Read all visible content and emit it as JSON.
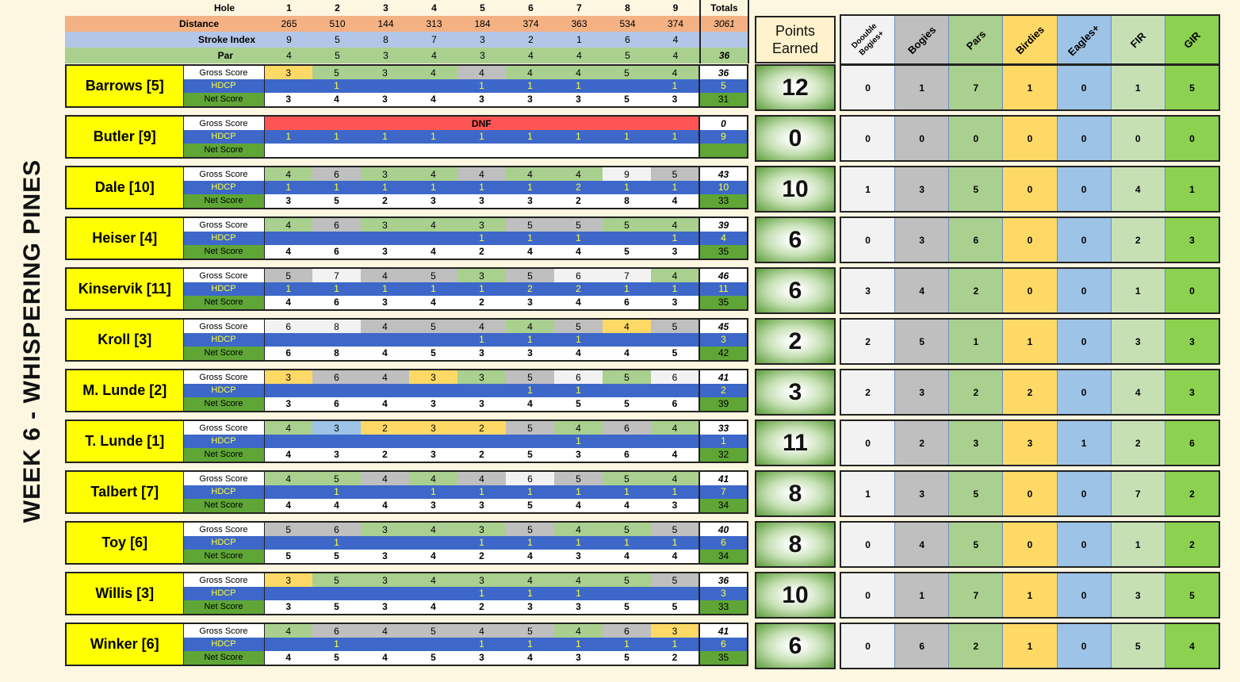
{
  "title": "WEEK 6 - WHISPERING PINES",
  "header": {
    "hole_label": "Hole",
    "holes": [
      "1",
      "2",
      "3",
      "4",
      "5",
      "6",
      "7",
      "8",
      "9"
    ],
    "totals_label": "Totals",
    "distance_label": "Distance",
    "distances": [
      "265",
      "510",
      "144",
      "313",
      "184",
      "374",
      "363",
      "534",
      "374"
    ],
    "distance_total": "3061",
    "stroke_index_label": "Stroke Index",
    "stroke_index": [
      "9",
      "5",
      "8",
      "7",
      "3",
      "2",
      "1",
      "6",
      "4"
    ],
    "par_label": "Par",
    "par": [
      "4",
      "5",
      "3",
      "4",
      "3",
      "4",
      "4",
      "5",
      "4"
    ],
    "par_total": "36"
  },
  "row_labels": {
    "gross": "Gross Score",
    "hdcp": "HDCP",
    "net": "Net Score"
  },
  "points_header": {
    "line1": "Points",
    "line2": "Earned"
  },
  "stats_header": [
    "Doouble Bogies+",
    "Bogies",
    "Pars",
    "Birdies",
    "Eagles+",
    "FIR",
    "GIR"
  ],
  "colors": {
    "name_bg": "#ffff00",
    "hdcp_bg": "#3d68c9",
    "hdcp_text": "#ffff33",
    "net_label_bg": "#5fa636",
    "dnf": "#ff5555"
  },
  "players": [
    {
      "name": "Barrows [5]",
      "gross": [
        "3",
        "5",
        "3",
        "4",
        "4",
        "4",
        "4",
        "5",
        "4"
      ],
      "gross_class": [
        "y",
        "g",
        "g",
        "g",
        "x",
        "g",
        "g",
        "g",
        "g"
      ],
      "gross_total": "36",
      "hdcp": [
        "",
        "1",
        "",
        "",
        "1",
        "1",
        "1",
        "",
        "1"
      ],
      "hdcp_total": "5",
      "net": [
        "3",
        "4",
        "3",
        "4",
        "3",
        "3",
        "3",
        "5",
        "3"
      ],
      "net_total": "31",
      "points": "12",
      "stats": [
        "0",
        "1",
        "7",
        "1",
        "0",
        "1",
        "5"
      ]
    },
    {
      "name": "Butler [9]",
      "dnf": "DNF",
      "gross_total": "0",
      "hdcp": [
        "1",
        "1",
        "1",
        "1",
        "1",
        "1",
        "1",
        "1",
        "1"
      ],
      "hdcp_total": "9",
      "net": [
        "",
        "",
        "",
        "",
        "",
        "",
        "",
        "",
        ""
      ],
      "net_total": "",
      "points": "0",
      "stats": [
        "0",
        "0",
        "0",
        "0",
        "0",
        "0",
        "0"
      ]
    },
    {
      "name": "Dale [10]",
      "gross": [
        "4",
        "6",
        "3",
        "4",
        "4",
        "4",
        "4",
        "9",
        "5"
      ],
      "gross_class": [
        "g",
        "x",
        "g",
        "g",
        "x",
        "g",
        "g",
        "w",
        "x"
      ],
      "gross_total": "43",
      "hdcp": [
        "1",
        "1",
        "1",
        "1",
        "1",
        "1",
        "2",
        "1",
        "1"
      ],
      "hdcp_total": "10",
      "net": [
        "3",
        "5",
        "2",
        "3",
        "3",
        "3",
        "2",
        "8",
        "4"
      ],
      "net_total": "33",
      "points": "10",
      "stats": [
        "1",
        "3",
        "5",
        "0",
        "0",
        "4",
        "1"
      ]
    },
    {
      "name": "Heiser [4]",
      "gross": [
        "4",
        "6",
        "3",
        "4",
        "3",
        "5",
        "5",
        "5",
        "4"
      ],
      "gross_class": [
        "g",
        "x",
        "g",
        "g",
        "g",
        "x",
        "x",
        "g",
        "g"
      ],
      "gross_total": "39",
      "hdcp": [
        "",
        "",
        "",
        "",
        "1",
        "1",
        "1",
        "",
        "1"
      ],
      "hdcp_total": "4",
      "net": [
        "4",
        "6",
        "3",
        "4",
        "2",
        "4",
        "4",
        "5",
        "3"
      ],
      "net_total": "35",
      "points": "6",
      "stats": [
        "0",
        "3",
        "6",
        "0",
        "0",
        "2",
        "3"
      ]
    },
    {
      "name": "Kinservik [11]",
      "gross": [
        "5",
        "7",
        "4",
        "5",
        "3",
        "5",
        "6",
        "7",
        "4"
      ],
      "gross_class": [
        "x",
        "w",
        "x",
        "x",
        "g",
        "x",
        "w",
        "w",
        "g"
      ],
      "gross_total": "46",
      "hdcp": [
        "1",
        "1",
        "1",
        "1",
        "1",
        "2",
        "2",
        "1",
        "1"
      ],
      "hdcp_total": "11",
      "net": [
        "4",
        "6",
        "3",
        "4",
        "2",
        "3",
        "4",
        "6",
        "3"
      ],
      "net_total": "35",
      "points": "6",
      "stats": [
        "3",
        "4",
        "2",
        "0",
        "0",
        "1",
        "0"
      ]
    },
    {
      "name": "Kroll [3]",
      "gross": [
        "6",
        "8",
        "4",
        "5",
        "4",
        "4",
        "5",
        "4",
        "5"
      ],
      "gross_class": [
        "w",
        "w",
        "x",
        "x",
        "x",
        "g",
        "x",
        "y",
        "x"
      ],
      "gross_total": "45",
      "hdcp": [
        "",
        "",
        "",
        "",
        "1",
        "1",
        "1",
        "",
        ""
      ],
      "hdcp_total": "3",
      "net": [
        "6",
        "8",
        "4",
        "5",
        "3",
        "3",
        "4",
        "4",
        "5"
      ],
      "net_total": "42",
      "points": "2",
      "stats": [
        "2",
        "5",
        "1",
        "1",
        "0",
        "3",
        "3"
      ]
    },
    {
      "name": "M. Lunde [2]",
      "gross": [
        "3",
        "6",
        "4",
        "3",
        "3",
        "5",
        "6",
        "5",
        "6"
      ],
      "gross_class": [
        "y",
        "x",
        "x",
        "y",
        "g",
        "x",
        "w",
        "g",
        "w"
      ],
      "gross_total": "41",
      "hdcp": [
        "",
        "",
        "",
        "",
        "",
        "1",
        "1",
        "",
        ""
      ],
      "hdcp_total": "2",
      "net": [
        "3",
        "6",
        "4",
        "3",
        "3",
        "4",
        "5",
        "5",
        "6"
      ],
      "net_total": "39",
      "points": "3",
      "stats": [
        "2",
        "3",
        "2",
        "2",
        "0",
        "4",
        "3"
      ]
    },
    {
      "name": "T. Lunde [1]",
      "gross": [
        "4",
        "3",
        "2",
        "3",
        "2",
        "5",
        "4",
        "6",
        "4"
      ],
      "gross_class": [
        "g",
        "b",
        "y",
        "y",
        "y",
        "x",
        "g",
        "x",
        "g"
      ],
      "gross_total": "33",
      "hdcp": [
        "",
        "",
        "",
        "",
        "",
        "",
        "1",
        "",
        ""
      ],
      "hdcp_total": "1",
      "net": [
        "4",
        "3",
        "2",
        "3",
        "2",
        "5",
        "3",
        "6",
        "4"
      ],
      "net_total": "32",
      "points": "11",
      "stats": [
        "0",
        "2",
        "3",
        "3",
        "1",
        "2",
        "6"
      ]
    },
    {
      "name": "Talbert [7]",
      "gross": [
        "4",
        "5",
        "4",
        "4",
        "4",
        "6",
        "5",
        "5",
        "4"
      ],
      "gross_class": [
        "g",
        "g",
        "x",
        "g",
        "x",
        "w",
        "x",
        "g",
        "g"
      ],
      "gross_total": "41",
      "hdcp": [
        "",
        "1",
        "",
        "1",
        "1",
        "1",
        "1",
        "1",
        "1"
      ],
      "hdcp_total": "7",
      "net": [
        "4",
        "4",
        "4",
        "3",
        "3",
        "5",
        "4",
        "4",
        "3"
      ],
      "net_total": "34",
      "points": "8",
      "stats": [
        "1",
        "3",
        "5",
        "0",
        "0",
        "7",
        "2"
      ]
    },
    {
      "name": "Toy [6]",
      "gross": [
        "5",
        "6",
        "3",
        "4",
        "3",
        "5",
        "4",
        "5",
        "5"
      ],
      "gross_class": [
        "x",
        "x",
        "g",
        "g",
        "g",
        "x",
        "g",
        "g",
        "x"
      ],
      "gross_total": "40",
      "hdcp": [
        "",
        "1",
        "",
        "",
        "1",
        "1",
        "1",
        "1",
        "1"
      ],
      "hdcp_total": "6",
      "net": [
        "5",
        "5",
        "3",
        "4",
        "2",
        "4",
        "3",
        "4",
        "4"
      ],
      "net_total": "34",
      "points": "8",
      "stats": [
        "0",
        "4",
        "5",
        "0",
        "0",
        "1",
        "2"
      ]
    },
    {
      "name": "Willis [3]",
      "gross": [
        "3",
        "5",
        "3",
        "4",
        "3",
        "4",
        "4",
        "5",
        "5"
      ],
      "gross_class": [
        "y",
        "g",
        "g",
        "g",
        "g",
        "g",
        "g",
        "g",
        "x"
      ],
      "gross_total": "36",
      "hdcp": [
        "",
        "",
        "",
        "",
        "1",
        "1",
        "1",
        "",
        ""
      ],
      "hdcp_total": "3",
      "net": [
        "3",
        "5",
        "3",
        "4",
        "2",
        "3",
        "3",
        "5",
        "5"
      ],
      "net_total": "33",
      "points": "10",
      "stats": [
        "0",
        "1",
        "7",
        "1",
        "0",
        "3",
        "5"
      ]
    },
    {
      "name": "Winker [6]",
      "gross": [
        "4",
        "6",
        "4",
        "5",
        "4",
        "5",
        "4",
        "6",
        "3"
      ],
      "gross_class": [
        "g",
        "x",
        "x",
        "x",
        "x",
        "x",
        "g",
        "x",
        "y"
      ],
      "gross_total": "41",
      "hdcp": [
        "",
        "1",
        "",
        "",
        "1",
        "1",
        "1",
        "1",
        "1"
      ],
      "hdcp_total": "6",
      "net": [
        "4",
        "5",
        "4",
        "5",
        "3",
        "4",
        "3",
        "5",
        "2"
      ],
      "net_total": "35",
      "points": "6",
      "stats": [
        "0",
        "6",
        "2",
        "1",
        "0",
        "5",
        "4"
      ]
    }
  ]
}
